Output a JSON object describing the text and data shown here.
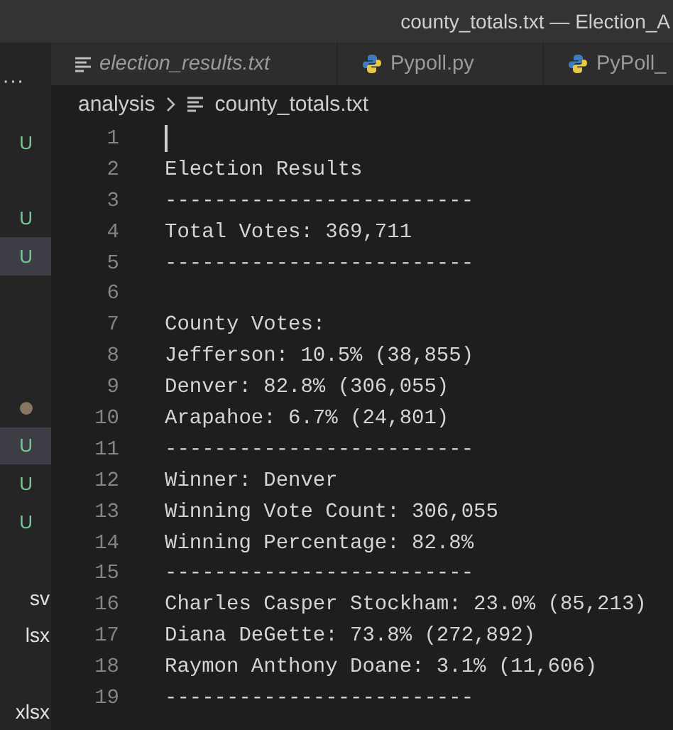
{
  "window": {
    "title": "county_totals.txt — Election_A"
  },
  "sidebar": {
    "overflow": "···",
    "rows": [
      {
        "kind": "badge",
        "text": "U",
        "selected": false
      },
      {
        "kind": "badge",
        "text": "U",
        "selected": false
      },
      {
        "kind": "badge",
        "text": "U",
        "selected": true
      },
      {
        "kind": "dot",
        "color": "#8a7560",
        "selected": false
      },
      {
        "kind": "badge",
        "text": "U",
        "selected": true
      },
      {
        "kind": "badge",
        "text": "U",
        "selected": false
      },
      {
        "kind": "badge",
        "text": "U",
        "selected": false
      },
      {
        "kind": "name",
        "text": "sv",
        "selected": false
      },
      {
        "kind": "name",
        "text": "lsx",
        "selected": false
      },
      {
        "kind": "name",
        "text": "xlsx",
        "selected": false
      }
    ]
  },
  "tabs": [
    {
      "label": "election_results.txt",
      "kind": "text",
      "italic": true
    },
    {
      "label": "Pypoll.py",
      "kind": "python",
      "italic": false
    },
    {
      "label": "PyPoll_",
      "kind": "python",
      "italic": false
    }
  ],
  "breadcrumb": {
    "folder": "analysis",
    "file": "county_totals.txt"
  },
  "editor": {
    "lines": [
      {
        "number": "1",
        "cursor": true
      },
      {
        "number": "2",
        "text": "Election Results"
      },
      {
        "number": "3",
        "text": "-------------------------"
      },
      {
        "number": "4",
        "text": "Total Votes: 369,711"
      },
      {
        "number": "5",
        "text": "-------------------------"
      },
      {
        "number": "6"
      },
      {
        "number": "7",
        "text": "County Votes:"
      },
      {
        "number": "8",
        "text": "Jefferson: 10.5% (38,855)"
      },
      {
        "number": "9",
        "text": "Denver: 82.8% (306,055)"
      },
      {
        "number": "10",
        "text": "Arapahoe: 6.7% (24,801)"
      },
      {
        "number": "11",
        "text": "-------------------------"
      },
      {
        "number": "12",
        "text": "Winner: Denver"
      },
      {
        "number": "13",
        "text": "Winning Vote Count: 306,055"
      },
      {
        "number": "14",
        "text": "Winning Percentage: 82.8%"
      },
      {
        "number": "15",
        "text": "-------------------------"
      },
      {
        "number": "16",
        "text": "Charles Casper Stockham: 23.0% (85,213)"
      },
      {
        "number": "17",
        "text": "Diana DeGette: 73.8% (272,892)"
      },
      {
        "number": "18",
        "text": "Raymon Anthony Doane: 3.1% (11,606)"
      },
      {
        "number": "19",
        "text": "-------------------------"
      }
    ]
  }
}
